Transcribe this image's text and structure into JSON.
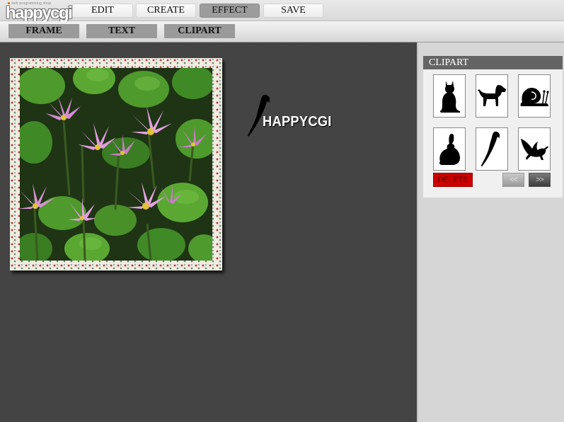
{
  "app": {
    "logo_text": "happycgi",
    "logo_tagline": "web programming shop"
  },
  "menu": {
    "items": [
      {
        "label": "EDIT",
        "active": false
      },
      {
        "label": "CREATE",
        "active": false
      },
      {
        "label": "EFFECT",
        "active": true
      },
      {
        "label": "SAVE",
        "active": false
      }
    ]
  },
  "submenu": {
    "items": [
      {
        "label": "FRAME"
      },
      {
        "label": "TEXT"
      },
      {
        "label": "CLIPART"
      }
    ]
  },
  "canvas": {
    "photo_icon": "water-lily-photo",
    "overlay_clipart_icon": "parrot-icon",
    "overlay_text": "HAPPYCGI"
  },
  "clipart_panel": {
    "title": "CLIPART",
    "items": [
      {
        "icon": "cat-icon"
      },
      {
        "icon": "dog-icon"
      },
      {
        "icon": "snail-icon"
      },
      {
        "icon": "rabbit-icon"
      },
      {
        "icon": "parrot-icon"
      },
      {
        "icon": "bird-icon"
      }
    ],
    "delete_label": "DELETE",
    "prev_label": "<<",
    "next_label": ">>"
  },
  "colors": {
    "workspace_bg": "#444444",
    "panel_header": "#646464",
    "delete_red": "#cc0000",
    "active_menu": "#9c9c9c"
  }
}
